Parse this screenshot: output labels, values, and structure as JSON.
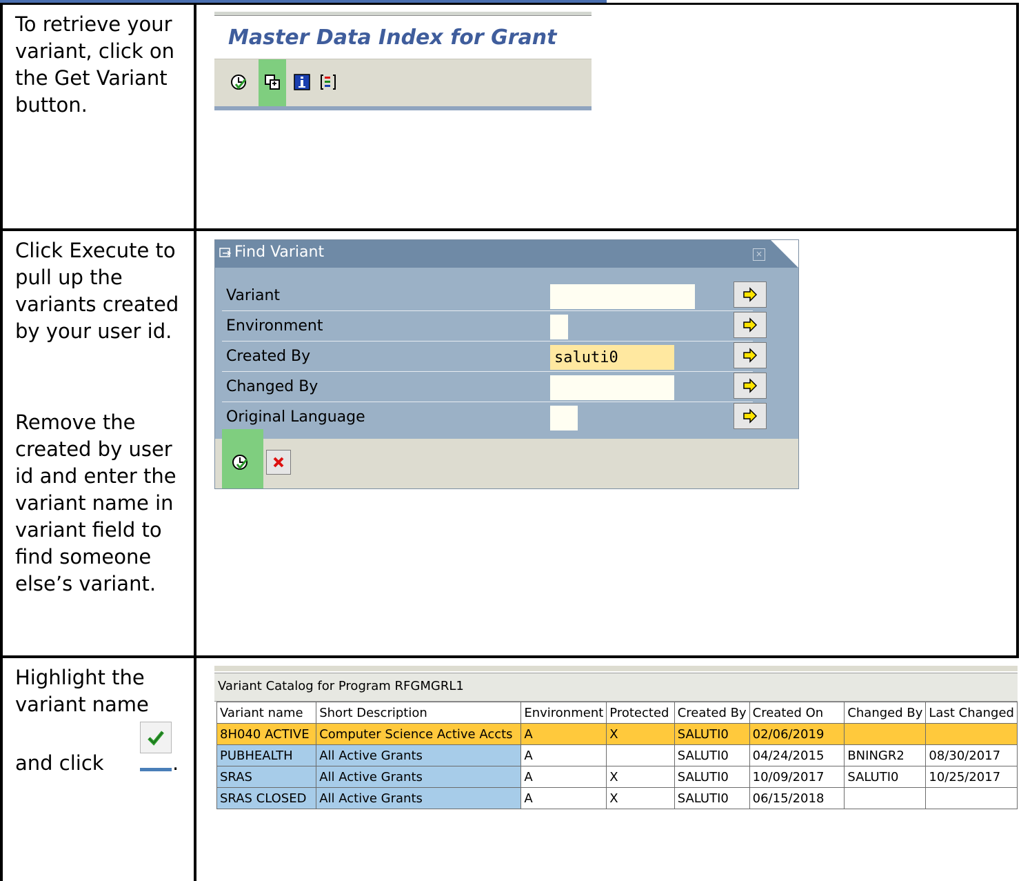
{
  "steps": [
    {
      "text": "To retrieve your variant, click on the Get Variant button."
    },
    {
      "text_1": "Click Execute to pull up the variants created by your user id.",
      "text_2": "Remove the created by user id and enter the variant name in variant field to find someone else’s variant."
    },
    {
      "text_1": "Highlight the variant name",
      "text_2": "and click",
      "text_3": "."
    }
  ],
  "sap_header": {
    "title": "Master Data Index for Grant",
    "toolbar": [
      "execute-icon",
      "get-variant-icon",
      "info-icon",
      "selection-options-icon"
    ]
  },
  "find_variant": {
    "title": "Find Variant",
    "fields": [
      {
        "label": "Variant",
        "value": ""
      },
      {
        "label": "Environment",
        "value": ""
      },
      {
        "label": "Created By",
        "value": "saluti0"
      },
      {
        "label": "Changed By",
        "value": ""
      },
      {
        "label": "Original Language",
        "value": ""
      }
    ],
    "buttons": [
      "execute-icon",
      "cancel-icon"
    ]
  },
  "catalog": {
    "title": "Variant Catalog for Program RFGMGRL1",
    "columns": [
      "Variant name",
      "Short Description",
      "Environment",
      "Protected",
      "Created By",
      "Created On",
      "Changed By",
      "Last Changed"
    ],
    "rows": [
      [
        "8H040 ACTIVE",
        "Computer Science Active Accts",
        "A",
        "X",
        "SALUTI0",
        "02/06/2019",
        "",
        ""
      ],
      [
        "PUBHEALTH",
        "All Active Grants",
        "A",
        "",
        "SALUTI0",
        "04/24/2015",
        "BNINGR2",
        "08/30/2017"
      ],
      [
        "SRAS",
        "All Active Grants",
        "A",
        "X",
        "SALUTI0",
        "10/09/2017",
        "SALUTI0",
        "10/25/2017"
      ],
      [
        "SRAS CLOSED",
        "All Active Grants",
        "A",
        "X",
        "SALUTI0",
        "06/15/2018",
        "",
        ""
      ]
    ]
  },
  "colors": {
    "sap_title": "#3f5d9c",
    "highlight_green": "#7fce7f",
    "selected_row": "#ffc93c",
    "key_column": "#a7cce9",
    "dialog_bg": "#9bb1c6"
  }
}
